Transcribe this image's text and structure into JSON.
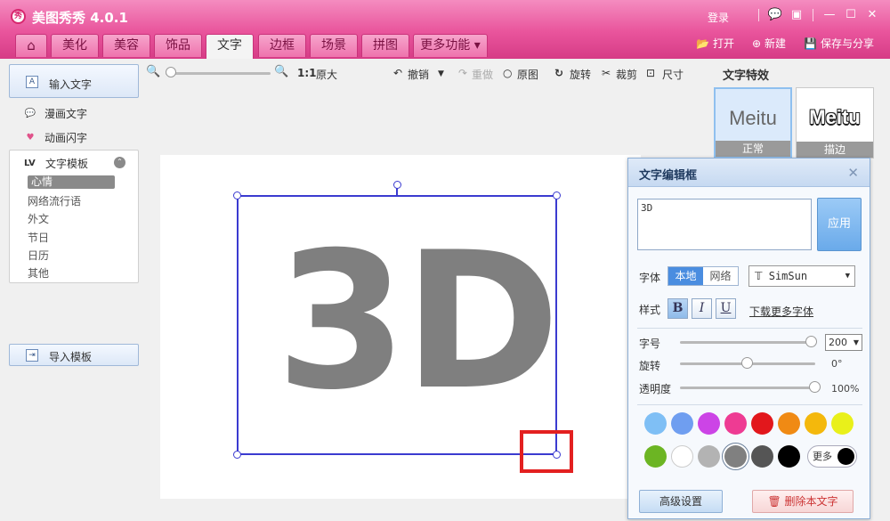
{
  "app": {
    "logo_text": "秀",
    "title": "美图秀秀 4.0.1",
    "login": "登录"
  },
  "window_icons": [
    "💬",
    "▣",
    "—",
    "☐",
    "✕"
  ],
  "tabs": [
    {
      "label": "⌂"
    },
    {
      "label": "美化"
    },
    {
      "label": "美容"
    },
    {
      "label": "饰品"
    },
    {
      "label": "文字"
    },
    {
      "label": "边框"
    },
    {
      "label": "场景"
    },
    {
      "label": "拼图"
    },
    {
      "label": "更多功能 ▾"
    }
  ],
  "file_actions": {
    "open": "打开",
    "new": "新建",
    "save_share": "保存与分享"
  },
  "sidebar": {
    "input_text": "输入文字",
    "comic_text": "漫画文字",
    "animated_text": "动画闪字",
    "template_header": "文字模板",
    "categories": [
      "心情",
      "网络流行语",
      "外文",
      "节日",
      "日历",
      "其他"
    ],
    "import_template": "导入模板"
  },
  "toolbar": {
    "ratio": "1:1",
    "original_size": "原大",
    "undo": "撤销",
    "redo": "重做",
    "original": "原图",
    "rotate": "旋转",
    "crop": "裁剪",
    "size": "尺寸"
  },
  "canvas": {
    "text": "3D"
  },
  "effects": {
    "title": "文字特效",
    "items": [
      {
        "sample": "Meitu",
        "label": "正常"
      },
      {
        "sample": "Meitu",
        "label": "描边"
      }
    ]
  },
  "dialog": {
    "title": "文字编辑框",
    "input_value": "3D",
    "apply": "应用",
    "font_label": "字体",
    "font_local": "本地",
    "font_web": "网络",
    "font_name": "SimSun",
    "style_label": "样式",
    "bold": "B",
    "italic": "I",
    "underline": "U",
    "download_fonts": "下载更多字体",
    "size_label": "字号",
    "size_value": "200",
    "size_fraction": 1.0,
    "rotate_label": "旋转",
    "rotate_value": "0°",
    "rotate_fraction": 0.5,
    "opacity_label": "透明度",
    "opacity_value": "100%",
    "opacity_fraction": 1.0,
    "colors": [
      "#7fbff5",
      "#6f9ef0",
      "#cc44e6",
      "#ee3b93",
      "#e2171c",
      "#f08a14",
      "#f4b80c",
      "#e9f01a",
      "#6cb523",
      "#ffffff",
      "#b3b3b3",
      "#808080",
      "#555555",
      "#000000"
    ],
    "selected_color": "#808080",
    "more": "更多",
    "advanced": "高级设置",
    "delete": "删除本文字"
  }
}
